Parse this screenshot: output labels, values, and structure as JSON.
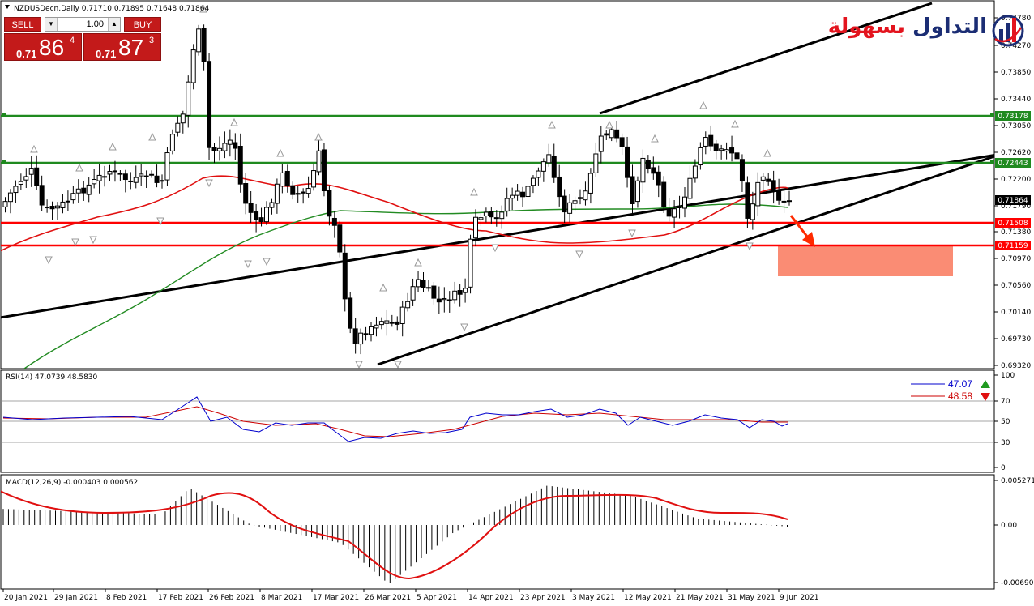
{
  "header": {
    "symbol_info": "NZDUSDecn,Daily  0.71710 0.71895 0.71648 0.71864"
  },
  "trade_panel": {
    "sell_label": "SELL",
    "buy_label": "BUY",
    "volume": "1.00",
    "sell_price_prefix": "0.71",
    "sell_price_big": "86",
    "sell_price_sup": "4",
    "buy_price_prefix": "0.71",
    "buy_price_big": "87",
    "buy_price_sup": "3"
  },
  "logo": {
    "word_blue": "التداول",
    "word_red": "بسهولة",
    "icon": "bar-chart-globe-icon"
  },
  "colors": {
    "bull_candle": "#ffffff",
    "bear_candle": "#000000",
    "resistance_green": "#1f8a1f",
    "support_red": "#ff0000",
    "channel_line": "#000000",
    "ma_red": "#e01010",
    "ma_green": "#228b22",
    "target_zone": "#fa8c74",
    "rsi_line": "#0000cd",
    "rsi_signal": "#cc0000"
  },
  "price_axis": {
    "labels": [
      "0.74780",
      "0.74270",
      "0.73850",
      "0.73440",
      "0.73050",
      "0.72620",
      "0.72200",
      "0.71790",
      "0.71380",
      "0.70970",
      "0.70560",
      "0.70140",
      "0.69730",
      "0.69320"
    ]
  },
  "level_tags": {
    "green_upper": "0.73178",
    "green_lower": "0.72443",
    "current": "0.71864",
    "red_upper": "0.71508",
    "red_lower": "0.71159"
  },
  "date_axis": {
    "labels": [
      "20 Jan 2021",
      "29 Jan 2021",
      "8 Feb 2021",
      "17 Feb 2021",
      "26 Feb 2021",
      "8 Mar 2021",
      "17 Mar 2021",
      "26 Mar 2021",
      "5 Apr 2021",
      "14 Apr 2021",
      "23 Apr 2021",
      "3 May 2021",
      "12 May 2021",
      "21 May 2021",
      "31 May 2021",
      "9 Jun 2021"
    ]
  },
  "rsi": {
    "title": "RSI(14) 47.0739 48.5830",
    "value_main": "47.07",
    "value_signal": "48.58",
    "axis": [
      "100",
      "70",
      "50",
      "30",
      "0"
    ]
  },
  "macd": {
    "title": "MACD(12,26,9) -0.000403 0.000562",
    "axis": [
      "0.005271",
      "0.00",
      "-0.006908"
    ]
  }
}
